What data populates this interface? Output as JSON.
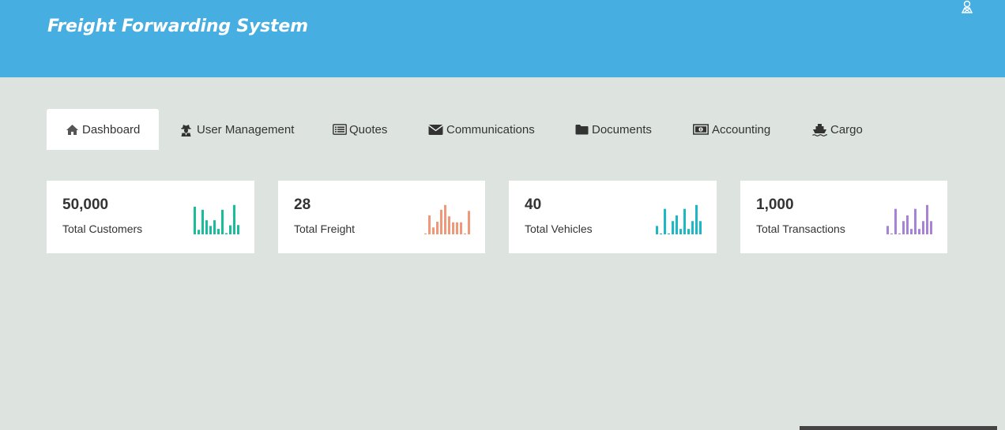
{
  "header": {
    "title": "Freight Forwarding System",
    "user_icon": "user-avatar-icon",
    "background": "#46aee0"
  },
  "tabs": [
    {
      "label": "Dashboard",
      "icon": "home-icon",
      "active": true
    },
    {
      "label": "User Management",
      "icon": "user-secret-icon",
      "active": false
    },
    {
      "label": "Quotes",
      "icon": "list-alt-icon",
      "active": false
    },
    {
      "label": "Communications",
      "icon": "envelope-icon",
      "active": false
    },
    {
      "label": "Documents",
      "icon": "folder-icon",
      "active": false
    },
    {
      "label": "Accounting",
      "icon": "money-icon",
      "active": false
    },
    {
      "label": "Cargo",
      "icon": "ship-icon",
      "active": false
    }
  ],
  "stats": [
    {
      "value": "50,000",
      "label": "Total Customers",
      "color": "#1abc9c",
      "spark": [
        0.92,
        0.15,
        0.82,
        0.47,
        0.28,
        0.47,
        0.18,
        0.82,
        0.04,
        0.3,
        0.98,
        0.31
      ]
    },
    {
      "value": "28",
      "label": "Total Freight",
      "color": "#f0997a",
      "spark": [
        0.03,
        0.63,
        0.23,
        0.42,
        0.82,
        0.98,
        0.6,
        0.4,
        0.4,
        0.4,
        0.03,
        0.78
      ]
    },
    {
      "value": "40",
      "label": "Total Vehicles",
      "color": "#1cb8c4",
      "spark": [
        0.28,
        0.03,
        0.85,
        0.03,
        0.44,
        0.63,
        0.18,
        0.85,
        0.18,
        0.44,
        0.98,
        0.44
      ]
    },
    {
      "value": "1,000",
      "label": "Total Transactions",
      "color": "#a683d6",
      "spark": [
        0.28,
        0.03,
        0.85,
        0.03,
        0.44,
        0.63,
        0.18,
        0.85,
        0.18,
        0.44,
        0.98,
        0.44
      ]
    }
  ]
}
